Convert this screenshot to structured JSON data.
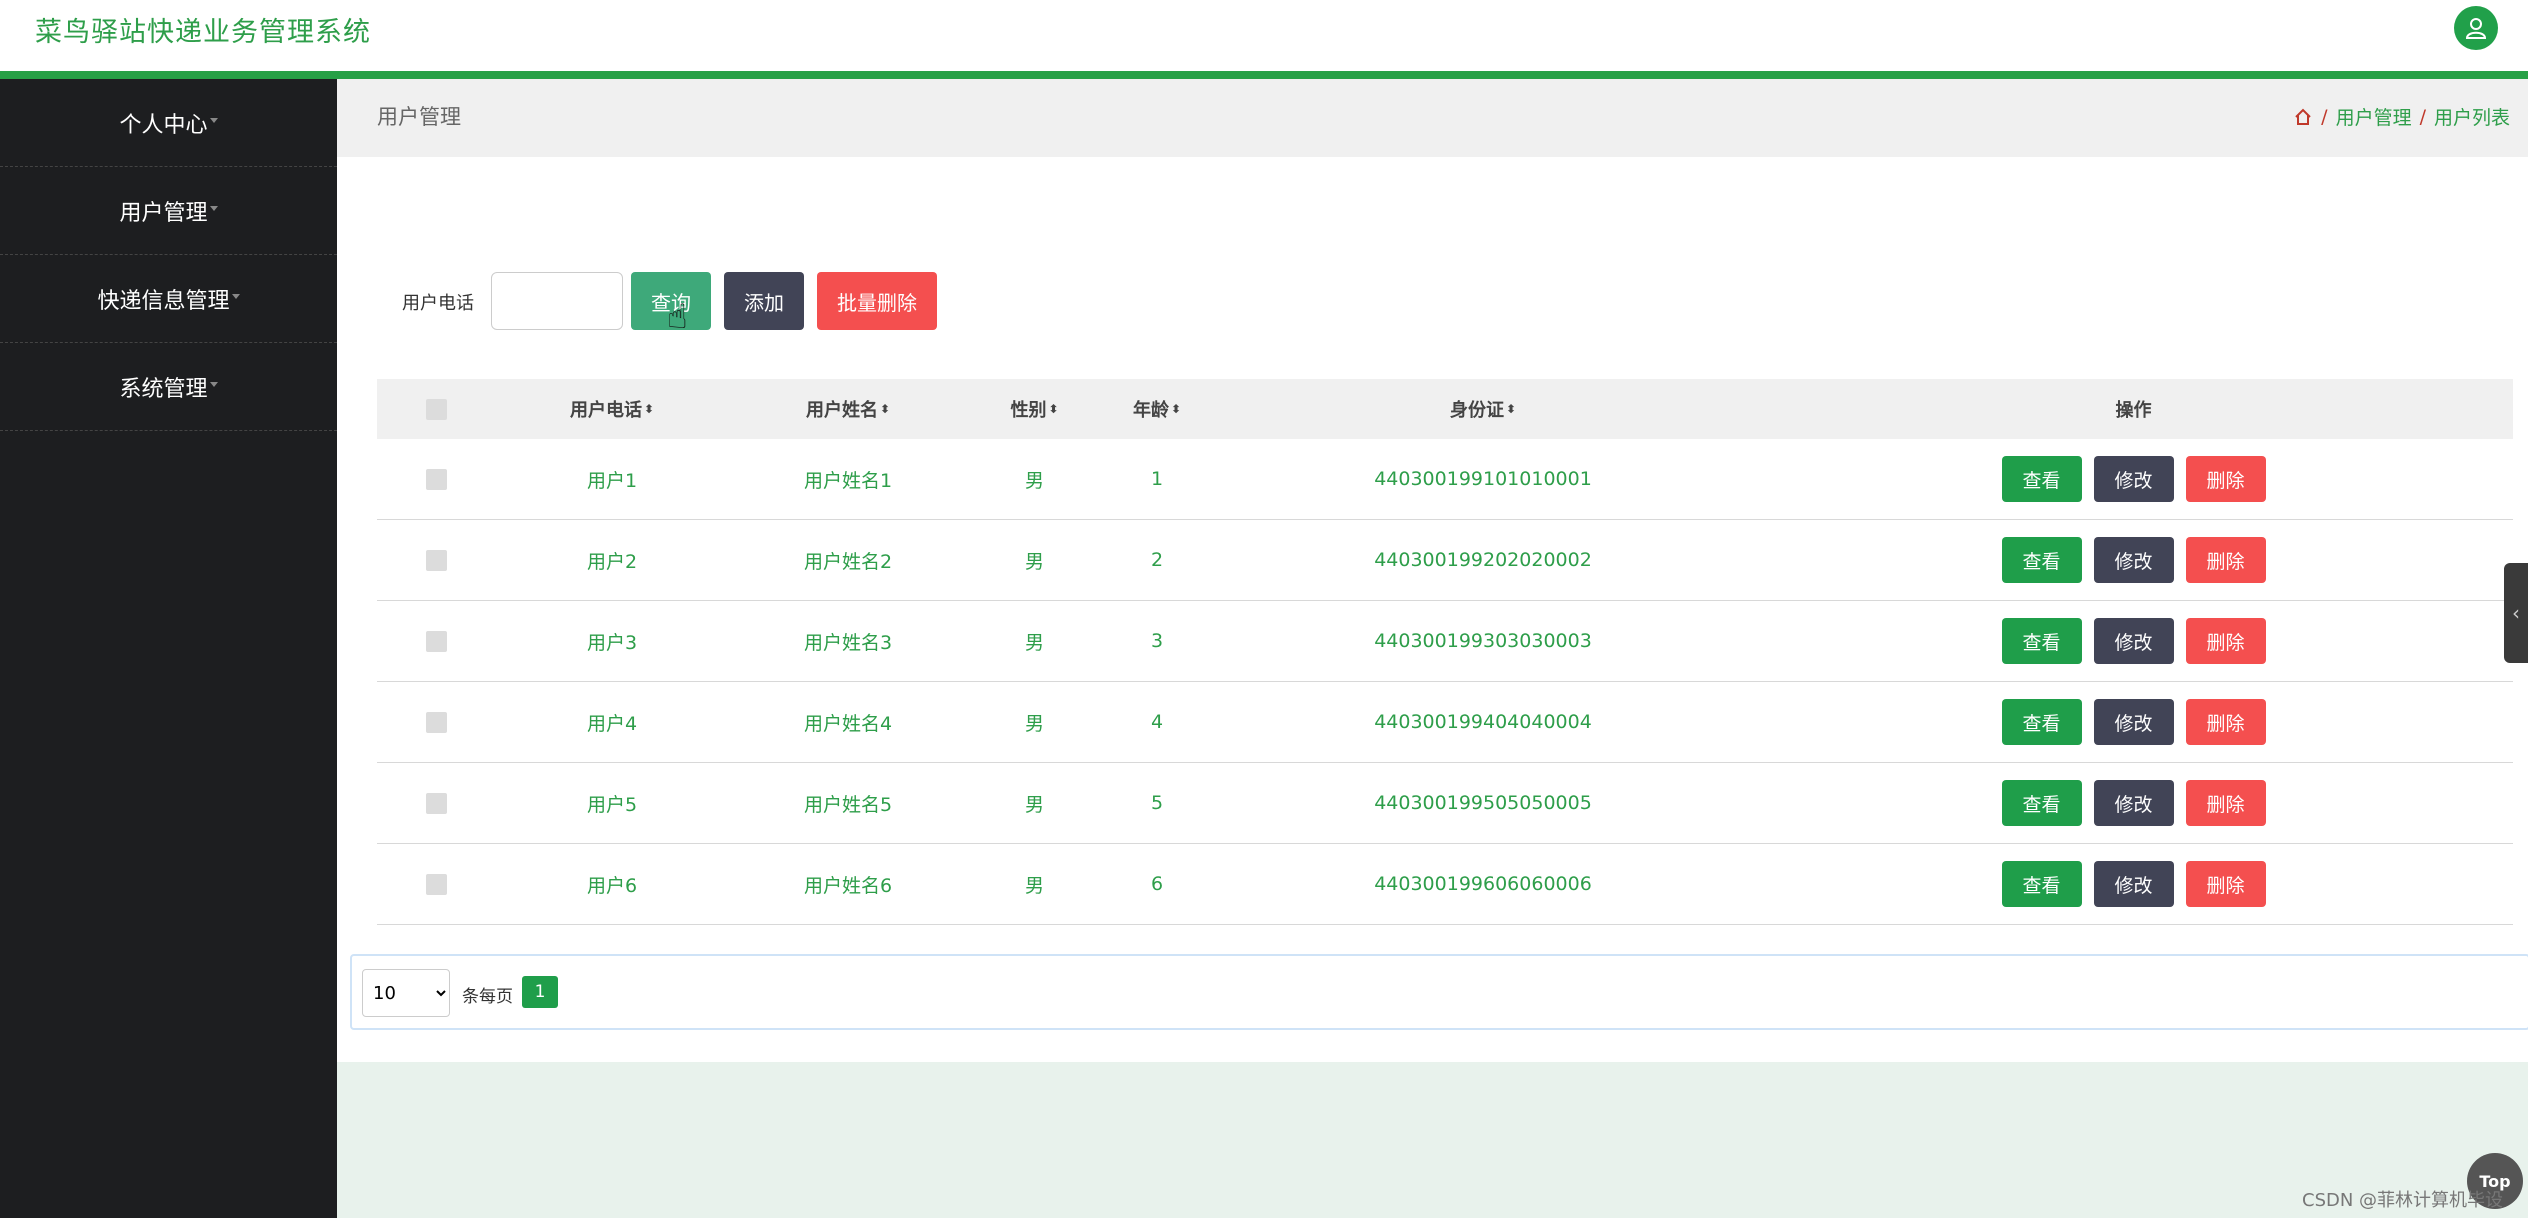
{
  "header": {
    "title": "菜鸟驿站快递业务管理系统",
    "avatar_icon": "user-icon"
  },
  "sidebar": {
    "items": [
      {
        "label": "个人中心"
      },
      {
        "label": "用户管理"
      },
      {
        "label": "快递信息管理"
      },
      {
        "label": "系统管理"
      }
    ]
  },
  "page": {
    "title": "用户管理",
    "breadcrumb": [
      "用户管理",
      "用户列表"
    ]
  },
  "search": {
    "label": "用户电话",
    "value": "",
    "search_button": "查询",
    "add_button": "添加",
    "batch_delete_button": "批量删除"
  },
  "table": {
    "columns": [
      "用户电话",
      "用户姓名",
      "性别",
      "年龄",
      "身份证",
      "操作"
    ],
    "rows": [
      {
        "phone": "用户1",
        "name": "用户姓名1",
        "gender": "男",
        "age": "1",
        "id": "440300199101010001"
      },
      {
        "phone": "用户2",
        "name": "用户姓名2",
        "gender": "男",
        "age": "2",
        "id": "440300199202020002"
      },
      {
        "phone": "用户3",
        "name": "用户姓名3",
        "gender": "男",
        "age": "3",
        "id": "440300199303030003"
      },
      {
        "phone": "用户4",
        "name": "用户姓名4",
        "gender": "男",
        "age": "4",
        "id": "440300199404040004"
      },
      {
        "phone": "用户5",
        "name": "用户姓名5",
        "gender": "男",
        "age": "5",
        "id": "440300199505050005"
      },
      {
        "phone": "用户6",
        "name": "用户姓名6",
        "gender": "男",
        "age": "6",
        "id": "440300199606060006"
      }
    ],
    "actions": {
      "view": "查看",
      "edit": "修改",
      "delete": "删除"
    }
  },
  "pager": {
    "page_size": "10",
    "page_size_label": "条每页",
    "current_page": "1"
  },
  "top_button": "Top",
  "watermark": "CSDN @菲林计算机毕设",
  "colors": {
    "brand": "#27a046",
    "sidebar": "#1d1e20",
    "danger": "#f44f4f",
    "dark_button": "#414456"
  }
}
